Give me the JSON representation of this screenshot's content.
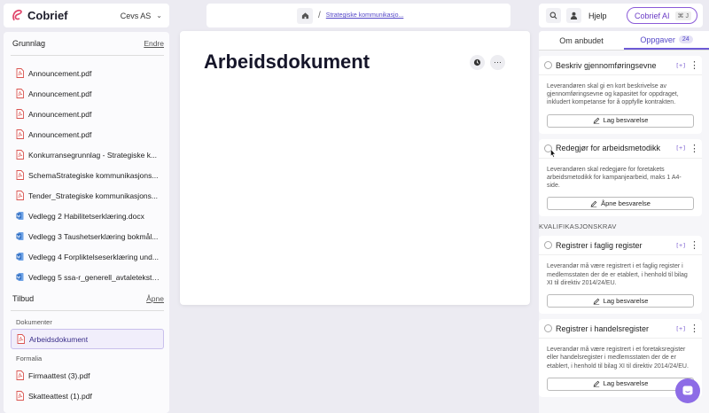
{
  "app": {
    "name": "Cobrief",
    "org": "Cevs AS"
  },
  "left": {
    "grunnlag": {
      "title": "Grunnlag",
      "action": "Endre",
      "files": [
        {
          "name": "Announcement.pdf",
          "type": "pdf"
        },
        {
          "name": "Announcement.pdf",
          "type": "pdf"
        },
        {
          "name": "Announcement.pdf",
          "type": "pdf"
        },
        {
          "name": "Announcement.pdf",
          "type": "pdf"
        },
        {
          "name": "Konkurransegrunnlag - Strategiske k...",
          "type": "pdf"
        },
        {
          "name": "SchemaStrategiske kommunikasjons...",
          "type": "pdf"
        },
        {
          "name": "Tender_Strategiske kommunikasjons...",
          "type": "pdf"
        },
        {
          "name": "Vedlegg 2 Habilitetserklæring.docx",
          "type": "docx"
        },
        {
          "name": "Vedlegg 3 Taushetserklæring bokmål...",
          "type": "docx"
        },
        {
          "name": "Vedlegg 4 Forpliktelseserklæring und...",
          "type": "docx"
        },
        {
          "name": "Vedlegg 5 ssa-r_generell_avtaletekst_...",
          "type": "docx"
        }
      ]
    },
    "tilbud": {
      "title": "Tilbud",
      "action": "Åpne",
      "dokumenter_label": "Dokumenter",
      "active_doc": "Arbeidsdokument",
      "formalia_label": "Formalia",
      "formalia": [
        {
          "name": "Firmaattest (3).pdf",
          "type": "pdf"
        },
        {
          "name": "Skatteattest (1).pdf",
          "type": "pdf"
        }
      ]
    }
  },
  "breadcrumb": {
    "current": "Strategiske kommunikasjo..."
  },
  "document": {
    "title": "Arbeidsdokument"
  },
  "topbar_right": {
    "help": "Hjelp",
    "ai": "Cobrief AI",
    "ai_shortcut": "⌘ J"
  },
  "right": {
    "tabs": [
      {
        "label": "Om anbudet",
        "active": false
      },
      {
        "label": "Oppgaver",
        "active": true,
        "badge": "24"
      }
    ],
    "ref_icon": "[+]",
    "tasks_top": [
      {
        "title": "Beskriv gjennomføringsevne",
        "body": "Leverandøren skal gi en kort beskrivelse av gjennomføringsevne og kapasitet for oppdraget, inkludert kompetanse for å oppfylle kontrakten.",
        "button": "Lag besvarelse"
      },
      {
        "title": "Redegjør for arbeidsmetodikk",
        "body": "Leverandøren skal redegjøre for foretakets arbeidsmetodikk for kampanjearbeid, maks 1 A4-side.",
        "button": "Åpne besvarelse"
      }
    ],
    "section": "KVALIFIKASJONSKRAV",
    "tasks_bottom": [
      {
        "title": "Registrer i faglig register",
        "body": "Leverandør må være registrert i et faglig register i medlemsstaten der de er etablert, i henhold til bilag XI til direktiv 2014/24/EU.",
        "button": "Lag besvarelse"
      },
      {
        "title": "Registrer i handelsregister",
        "body": "Leverandør må være registrert i et foretaksregister eller handelsregister i medlemsstaten der de er etablert, i henhold til bilag XI til direktiv 2014/24/EU.",
        "button": "Lag besvarelse"
      }
    ]
  },
  "colors": {
    "accent": "#6d5ad6",
    "logo": "#e0456b",
    "pdf": "#d9534f",
    "word": "#2b6cc4",
    "chat": "#8d6ce6"
  }
}
